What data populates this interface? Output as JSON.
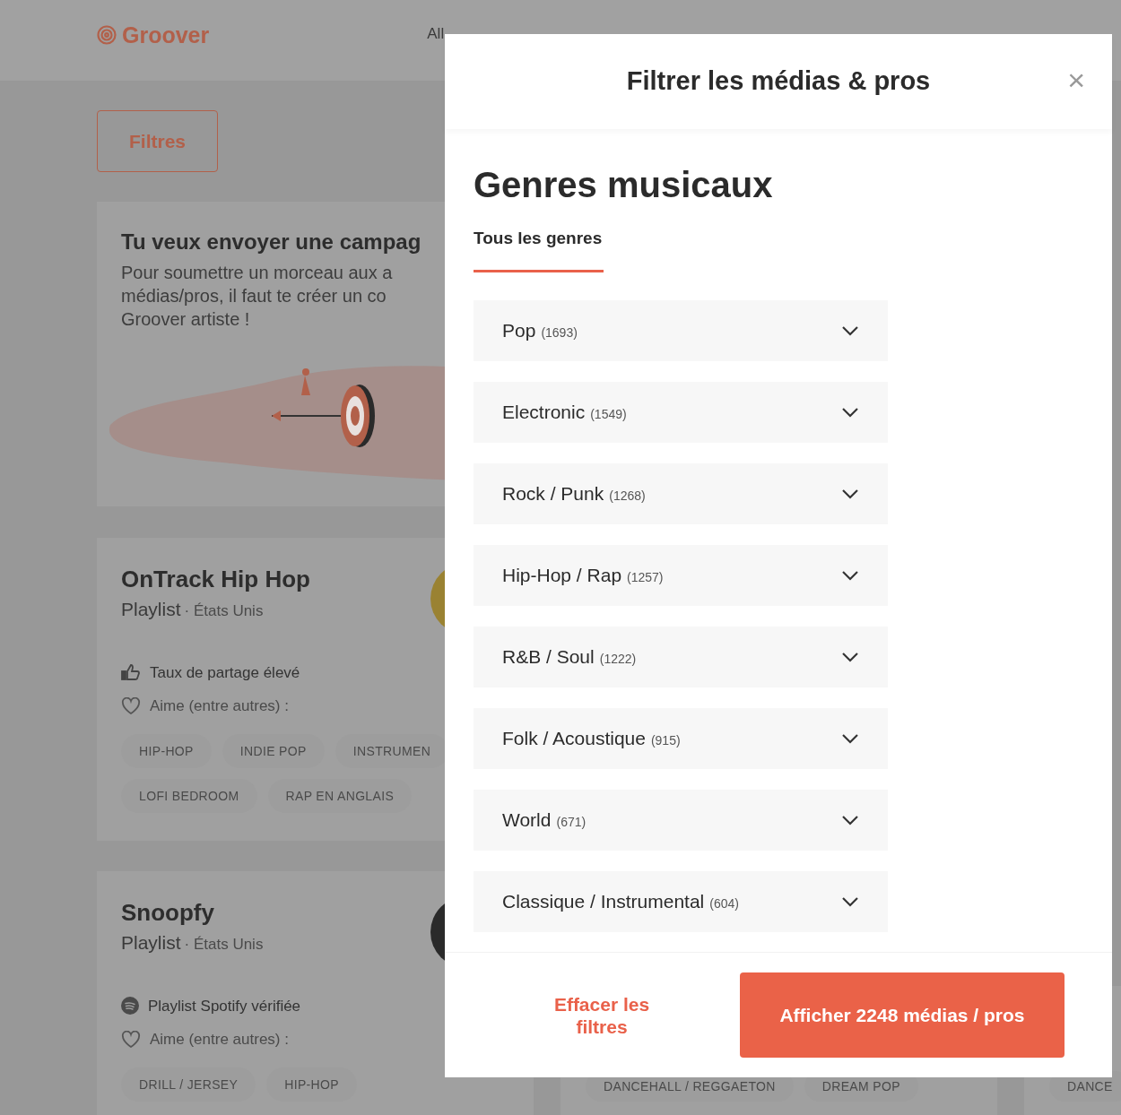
{
  "header": {
    "logo": "Groover",
    "nav": [
      "All"
    ]
  },
  "filters_button": "Filtres",
  "promo": {
    "title": "Tu veux envoyer une campag",
    "text": "Pour soumettre un morceau aux a\nmédias/pros, il faut te créer un co\nGroover artiste !"
  },
  "curators": [
    {
      "name": "OnTrack Hip Hop",
      "type": "Playlist",
      "country": "· États Unis",
      "badge": {
        "kind": "share",
        "text": "Taux de partage élevé"
      },
      "likes": "Aime (entre autres) :",
      "tags": [
        "HIP-HOP",
        "INDIE POP",
        "INSTRUMEN",
        "LOFI BEDROOM",
        "RAP EN ANGLAIS"
      ]
    },
    {
      "name": "Snoopfy",
      "type": "Playlist",
      "country": "· États Unis",
      "badge": {
        "kind": "spotify",
        "text": "Playlist Spotify vérifiée"
      },
      "likes": "Aime (entre autres) :",
      "tags": [
        "DRILL / JERSEY",
        "HIP-HOP"
      ]
    }
  ],
  "column_2_tags": [
    "DANCEHALL / REGGAETON",
    "DREAM POP"
  ],
  "column_3_tags": [
    "DANCE"
  ],
  "modal": {
    "title": "Filtrer les médias & pros",
    "close": "×",
    "section_title": "Genres musicaux",
    "tabs": [
      {
        "label": "Tous les genres",
        "selected": true
      }
    ],
    "genres": [
      {
        "name": "Pop",
        "count": "(1693)",
        "expanded": false
      },
      {
        "name": "Electronic",
        "count": "(1549)",
        "expanded": false
      },
      {
        "name": "Rock / Punk",
        "count": "(1268)",
        "expanded": false
      },
      {
        "name": "Hip-Hop / Rap",
        "count": "(1257)",
        "expanded": false
      },
      {
        "name": "R&B / Soul",
        "count": "(1222)",
        "expanded": false
      },
      {
        "name": "Folk / Acoustique",
        "count": "(915)",
        "expanded": false
      },
      {
        "name": "World",
        "count": "(671)",
        "expanded": false
      },
      {
        "name": "Classique / Instrumental",
        "count": "(604)",
        "expanded": false
      }
    ],
    "clear_button": "Effacer les filtres",
    "apply_button": "Afficher 2248 médias / pros"
  }
}
